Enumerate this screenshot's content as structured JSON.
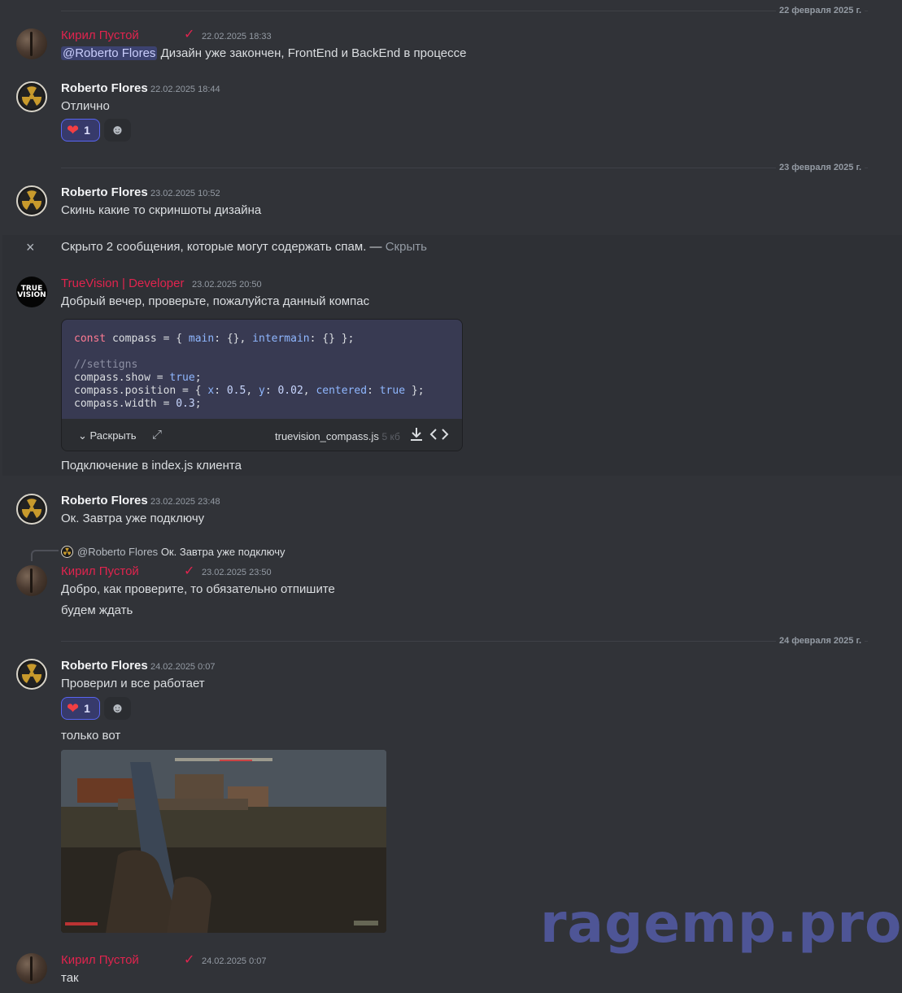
{
  "dates": {
    "d1": "22 февраля 2025 г.",
    "d2": "23 февраля 2025 г.",
    "d3": "24 февраля 2025 г."
  },
  "users": {
    "kiril": "Кирил Пустой",
    "roberto": "Roberto Flores",
    "truevision": "TrueVision | Developer"
  },
  "messages": {
    "m1": {
      "time": "22.02.2025 18:33",
      "mention": "@Roberto Flores",
      "text": " Дизайн уже закончен, FrontEnd и BackEnd в процессе"
    },
    "m2": {
      "time": "22.02.2025 18:44",
      "text": "Отлично",
      "reaction_count": "1"
    },
    "m3": {
      "time": "23.02.2025 10:52",
      "text": "Скинь какие то скриншоты дизайна"
    },
    "hidden": {
      "text": "Скрыто 2 сообщения, которые могут содержать спам. — ",
      "link": "Скрыть"
    },
    "m4": {
      "time": "23.02.2025 20:50",
      "text": "Добрый вечер, проверьте, пожалуйста данный компас",
      "after": "Подключение в index.js клиента",
      "code": {
        "expand_label": "Раскрыть",
        "filename": "truevision_compass.js",
        "filesize": "5 кб"
      }
    },
    "m5": {
      "time": "23.02.2025 23:48",
      "text": "Ок. Завтра уже подключу"
    },
    "m6": {
      "reply_mention": "@Roberto Flores",
      "reply_text": "Ок. Завтра уже подключу",
      "time": "23.02.2025 23:50",
      "text1": "Добро, как проверите, то обязательно отпишите",
      "text2": "будем ждать"
    },
    "m7": {
      "time": "24.02.2025 0:07",
      "text": "Проверил и все работает",
      "reaction_count": "1",
      "text2": "только вот"
    },
    "m8": {
      "time": "24.02.2025 0:07",
      "text": "так"
    }
  },
  "watermark": "ragemp.pro",
  "colors": {
    "accent": "#e0244e",
    "mention_bg": "#3c4270",
    "blurple": "#5865f2"
  },
  "icons": [
    "heart-icon",
    "add-reaction-icon",
    "close-icon",
    "verified-check-icon",
    "chevron-down-icon",
    "expand-icon",
    "download-icon",
    "code-icon"
  ]
}
